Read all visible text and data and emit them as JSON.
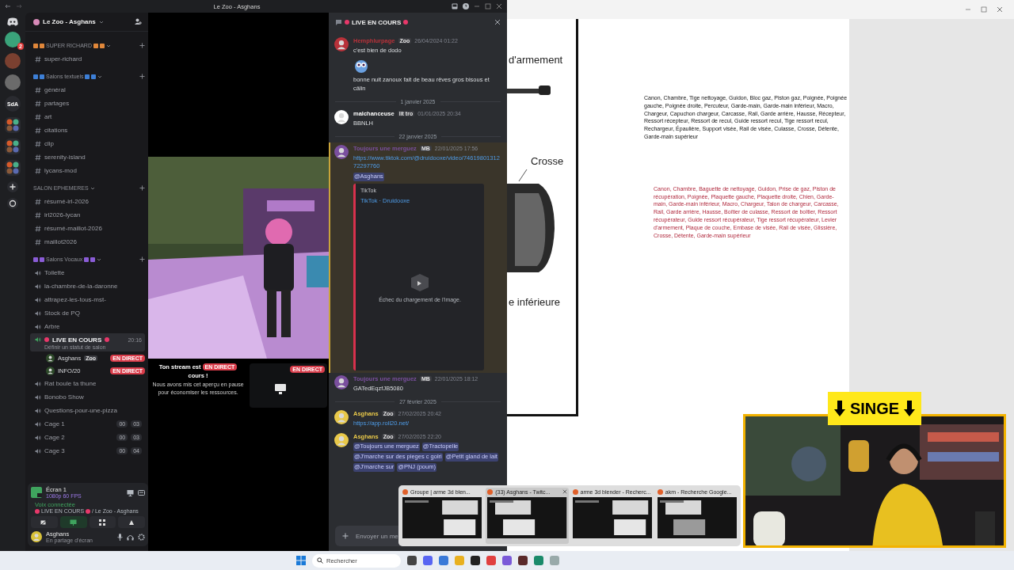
{
  "title_bar": {
    "title": "Le Zoo - Asghans"
  },
  "servers": [
    {
      "kind": "logo"
    },
    {
      "kind": "avatar",
      "badge": "2"
    },
    {
      "kind": "avatar"
    },
    {
      "kind": "avatar"
    },
    {
      "kind": "label",
      "label": "SdA"
    },
    {
      "kind": "folder"
    },
    {
      "kind": "folder"
    },
    {
      "kind": "folder"
    },
    {
      "kind": "add"
    },
    {
      "kind": "explore"
    }
  ],
  "sidebar": {
    "server_name": "Le Zoo - Asghans",
    "sections": [
      {
        "label": "SUPER RICHARD",
        "color": "#e0873a",
        "channels": [
          {
            "kind": "text",
            "name": "super-richard",
            "selected": false
          }
        ]
      },
      {
        "label": "Salons textuels",
        "color": "#3d7fd6",
        "channels": [
          {
            "kind": "text",
            "name": "général",
            "selected": false
          },
          {
            "kind": "text",
            "name": "partages",
            "selected": false
          },
          {
            "kind": "text",
            "name": "art",
            "selected": false
          },
          {
            "kind": "text",
            "name": "citations",
            "selected": false
          },
          {
            "kind": "text",
            "name": "clip",
            "selected": false
          },
          {
            "kind": "text",
            "name": "serenity-island",
            "selected": false
          },
          {
            "kind": "text",
            "name": "lycans-mod",
            "selected": false
          }
        ]
      },
      {
        "label": "SALON EPHEMERES",
        "channels": [
          {
            "kind": "text",
            "name": "résumé-irl-2026",
            "selected": false
          },
          {
            "kind": "text",
            "name": "irl2026-lycan",
            "selected": false
          },
          {
            "kind": "text",
            "name": "résumé-maillot-2026",
            "selected": false
          },
          {
            "kind": "text",
            "name": "maillot2026",
            "selected": false
          }
        ]
      },
      {
        "label": "Salons Vocaux",
        "color": "#8a5cd6",
        "channels": [
          {
            "kind": "voice",
            "name": "Toilette",
            "selected": false
          },
          {
            "kind": "voice",
            "name": "la-chambre-de-la-daronne",
            "selected": false
          },
          {
            "kind": "voice",
            "name": "attrapez-les-tous-mst-",
            "selected": false
          },
          {
            "kind": "voice",
            "name": "Stock de PQ",
            "selected": false
          },
          {
            "kind": "voice",
            "name": "Arbre",
            "selected": false
          },
          {
            "kind": "voice",
            "name": "LIVE EN COURS",
            "live": true,
            "time": "20:16",
            "status": "Définir un statut de salon",
            "selected": true,
            "members": [
              {
                "name": "Asghans",
                "badge": "Zoo",
                "tag": "EN DIRECT"
              },
              {
                "name": "INFO/20",
                "tag": "EN DIRECT"
              }
            ]
          },
          {
            "kind": "voice",
            "name": "Rat boule ta thune",
            "selected": false
          },
          {
            "kind": "voice",
            "name": "Bonobo Show",
            "selected": false
          },
          {
            "kind": "voice",
            "name": "Questions-pour-une-pizza",
            "selected": false
          },
          {
            "kind": "voice",
            "name": "Cage 1",
            "counts": [
              "00",
              "03"
            ],
            "selected": false
          },
          {
            "kind": "voice",
            "name": "Cage 2",
            "counts": [
              "00",
              "03"
            ],
            "selected": false
          },
          {
            "kind": "voice",
            "name": "Cage 3",
            "counts": [
              "00",
              "04"
            ],
            "selected": false
          }
        ]
      }
    ]
  },
  "panel": {
    "screen": {
      "title": "Écran 1",
      "quality": "1080p 60 FPS"
    },
    "voice": {
      "status": "Voix connectée",
      "channel": "LIVE EN COURS",
      "server": "/ Le Zoo - Asghans"
    },
    "user": {
      "name": "Asghans",
      "status": "En partage d'écran"
    }
  },
  "stream": {
    "notice_start": "Ton stream est",
    "notice_badge": "EN DIRECT",
    "notice_end": "cours !",
    "notice_body": "Nous avons mis cet aperçu en pause pour économiser les ressources.",
    "preview_badge": "EN DIRECT"
  },
  "chat": {
    "title": "LIVE EN COURS",
    "items": [
      {
        "kind": "message",
        "author": "Hemphlurpage",
        "color": "#b8323a",
        "badge": "Zoo",
        "time": "26/04/2024 01:22",
        "highlighted": false,
        "blocks": [
          {
            "kind": "text",
            "text": "c'est bien de dodo"
          },
          {
            "kind": "sticker"
          },
          {
            "kind": "text",
            "text": "bonne nuit zanoux fait de beau rêves gros bisous et câlin"
          }
        ]
      },
      {
        "kind": "divider",
        "text": "1 janvier 2025"
      },
      {
        "kind": "message",
        "author": "malchanceuse",
        "color": "#ffffff",
        "badge": "lit tro",
        "time": "01/01/2025 20:34",
        "highlighted": false,
        "blocks": [
          {
            "kind": "text",
            "text": "BBNLH"
          }
        ]
      },
      {
        "kind": "divider",
        "text": "22 janvier 2025"
      },
      {
        "kind": "message",
        "author": "Toujours une merguez",
        "color": "#7a4f9e",
        "badge": "MB",
        "time": "22/01/2025 17:56",
        "highlighted": true,
        "blocks": [
          {
            "kind": "inline",
            "segments": [
              {
                "kind": "link",
                "text": "https://www.tiktok.com/@druidooxe/video/7461980131272297760"
              },
              {
                "kind": "mention",
                "text": "@Asghans"
              }
            ]
          },
          {
            "kind": "embed",
            "provider": "TikTok",
            "title": "TikTok · Druidooxe",
            "error": "Échec du chargement de l'image."
          }
        ]
      },
      {
        "kind": "message",
        "author": "Toujours une merguez",
        "color": "#7a4f9e",
        "badge": "MB",
        "time": "22/01/2025 18:12",
        "highlighted": false,
        "blocks": [
          {
            "kind": "text",
            "text": "GATedEqzfJB5080"
          }
        ]
      },
      {
        "kind": "divider",
        "text": "27 février 2025"
      },
      {
        "kind": "message",
        "author": "Asghans",
        "color": "#e8c84a",
        "badge": "Zoo",
        "time": "27/02/2025 20:42",
        "highlighted": false,
        "blocks": [
          {
            "kind": "inline",
            "segments": [
              {
                "kind": "link",
                "text": "https://app.roll20.net/"
              }
            ]
          }
        ]
      },
      {
        "kind": "message",
        "author": "Asghans",
        "color": "#e8c84a",
        "badge": "Zoo",
        "time": "27/02/2025 22:20",
        "highlighted": false,
        "blocks": [
          {
            "kind": "inline",
            "segments": [
              {
                "kind": "mention",
                "text": "@Toujours une merguez"
              },
              {
                "kind": "mention",
                "text": "@Tractopelle"
              },
              {
                "kind": "mention",
                "text": "@J'marche sur des pieges c golri"
              },
              {
                "kind": "mention",
                "text": "@Petit gland de lait"
              },
              {
                "kind": "mention",
                "text": "@J'marche sur"
              },
              {
                "kind": "mention",
                "text": "@PNJ (poum)"
              }
            ]
          }
        ]
      }
    ],
    "input": {
      "placeholder": "Envoyer un me"
    }
  },
  "document": {
    "diagram_labels": [
      "d'armement",
      "Crosse",
      "e inférieure"
    ],
    "paragraphs": [
      {
        "kind": "black",
        "text": "Canon, Chambre, Tige nettoyage, Guidon, Bloc gaz, Piston gaz, Poignée, Poignée gauche, Poignée droite, Percuteur, Garde-main, Garde-main inférieur, Macro, Chargeur, Capuchon chargeur, Carcasse, Rail, Garde arrière, Hausse, Récepteur, Ressort récepteur, Ressort de recul, Guide ressort recul, Tige ressort recul, Rechargeur, Épaulière, Support visée, Rail de visée, Culasse, Crosse, Détente, Garde-main supérieur"
      },
      {
        "kind": "red",
        "text": "Canon, Chambre, Baguette de nettoyage, Guidon, Prise de gaz, Piston de récupération, Poignée, Plaquette gauche, Plaquette droite, Chien, Garde-main, Garde-main inférieur, Macro, Chargeur, Talon de chargeur, Carcasse, Rail, Garde arrière, Hausse, Boîtier de culasse, Ressort de boîtier, Ressort récupérateur, Guide ressort récupérateur, Tige ressort récupérateur, Levier d'armement, Plaque de couche, Embase de visée, Rail de visée, Glissière, Crosse, Détente, Garde-main supérieur"
      }
    ]
  },
  "webcam": {
    "banner": "SINGE"
  },
  "thumbnails": [
    {
      "title": "Groupe | arme 3d blen...",
      "selected": false
    },
    {
      "title": "(33) Asghans - Twitc...",
      "selected": true
    },
    {
      "title": "arme 3d blender - Recherc...",
      "selected": false
    },
    {
      "title": "akm - Recherche Google...",
      "selected": false
    }
  ],
  "taskbar": {
    "search_placeholder": "Rechercher"
  }
}
